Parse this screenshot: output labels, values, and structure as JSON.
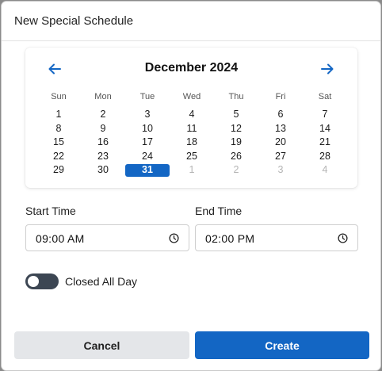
{
  "dialog": {
    "title": "New Special Schedule"
  },
  "calendar": {
    "month_label": "December 2024",
    "weekdays": [
      "Sun",
      "Mon",
      "Tue",
      "Wed",
      "Thu",
      "Fri",
      "Sat"
    ],
    "weeks": [
      [
        "1",
        "2",
        "3",
        "4",
        "5",
        "6",
        "7"
      ],
      [
        "8",
        "9",
        "10",
        "11",
        "12",
        "13",
        "14"
      ],
      [
        "15",
        "16",
        "17",
        "18",
        "19",
        "20",
        "21"
      ],
      [
        "22",
        "23",
        "24",
        "25",
        "26",
        "27",
        "28"
      ],
      [
        "29",
        "30",
        "31",
        "1",
        "2",
        "3",
        "4"
      ]
    ],
    "selected_day": "31",
    "outside_month_days": [
      "1",
      "2",
      "3",
      "4"
    ],
    "prev_icon": "arrow-left-icon",
    "next_icon": "arrow-right-icon",
    "accent_color": "#1366c4"
  },
  "start_time": {
    "label": "Start Time",
    "value": "09:00 AM",
    "icon": "clock-icon"
  },
  "end_time": {
    "label": "End Time",
    "value": "02:00 PM",
    "icon": "clock-icon"
  },
  "closed_all_day": {
    "label": "Closed All Day",
    "checked": false
  },
  "buttons": {
    "cancel_label": "Cancel",
    "create_label": "Create"
  }
}
